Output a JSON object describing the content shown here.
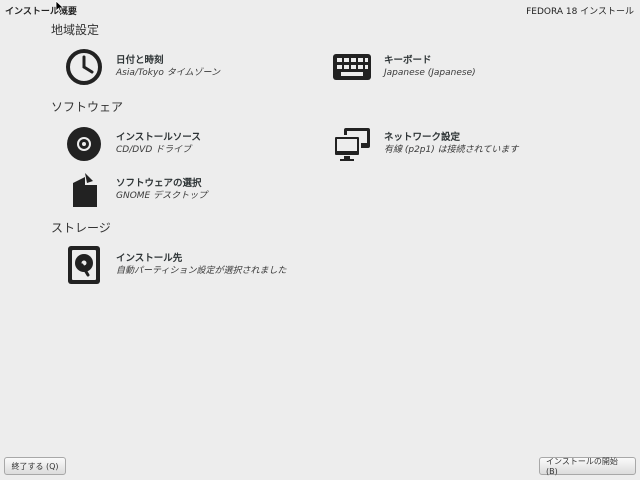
{
  "header": {
    "title": "インストール概要",
    "product": "FEDORA 18 インストール"
  },
  "sections": {
    "localization": "地域設定",
    "software": "ソフトウェア",
    "storage": "ストレージ"
  },
  "spokes": {
    "datetime": {
      "title": "日付と時刻",
      "status": "Asia/Tokyo タイムゾーン"
    },
    "keyboard": {
      "title": "キーボード",
      "status": "Japanese (Japanese)"
    },
    "source": {
      "title": "インストールソース",
      "status": "CD/DVD ドライブ"
    },
    "network": {
      "title": "ネットワーク設定",
      "status": "有線 (p2p1) は接続されています"
    },
    "software": {
      "title": "ソフトウェアの選択",
      "status": "GNOME デスクトップ"
    },
    "destination": {
      "title": "インストール先",
      "status": "自動パーティション設定が選択されました"
    }
  },
  "buttons": {
    "quit": "終了する (Q)",
    "begin": "インストールの開始(B)"
  }
}
